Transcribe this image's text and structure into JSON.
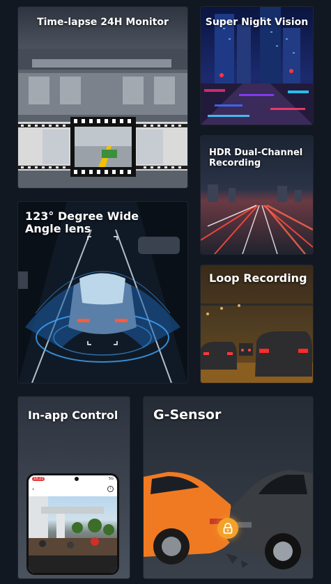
{
  "cards": {
    "timelapse": {
      "title": "Time-lapse 24H Monitor"
    },
    "night": {
      "title": "Super Night Vision"
    },
    "hdr": {
      "title": "HDR Dual-Channel Recording"
    },
    "wide": {
      "title": "123° Degree Wide Angle lens"
    },
    "loop": {
      "title": "Loop Recording"
    },
    "app": {
      "title": "In-app Control",
      "phone_time": "18:22",
      "phone_signal": "5G"
    },
    "gsensor": {
      "title": "G-Sensor"
    }
  },
  "icons": {
    "lock": "lock-icon",
    "back": "chevron-left-icon",
    "info": "info-icon"
  },
  "colors": {
    "background": "#121821",
    "lock_accent": "#f3a12a",
    "hud_blue": "#3fa7ff",
    "car_orange": "#f07a22"
  }
}
